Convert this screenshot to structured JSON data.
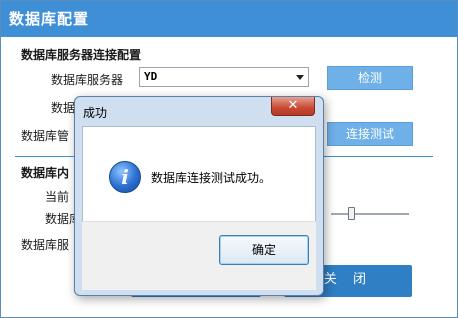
{
  "window": {
    "title": "数据库配置"
  },
  "server_section": {
    "heading": "数据库服务器连接配置",
    "server_label": "数据库服务器",
    "server_value": "YD",
    "detect_button": "检测",
    "row2_label_partial": "数据",
    "row3_label_partial": "数据库管",
    "test_connection_button": "连接测试"
  },
  "db_section": {
    "heading_partial": "数据库内",
    "current_label_partial": "当前",
    "db_label_partial": "数据库",
    "server_label_partial": "数据库服",
    "slider_level": 0.2
  },
  "footer": {
    "close_button": "关 闭"
  },
  "dialog": {
    "title": "成功",
    "close_icon": "close-icon",
    "info_icon": "info-icon",
    "info_icon_glyph": "i",
    "message": "数据库连接测试成功。",
    "ok_button": "确定"
  },
  "colors": {
    "titlebar": "#3f8fd6",
    "button_light": "#6fb0e8",
    "button_dark": "#2f7fc4",
    "close_button": "#c74a34"
  }
}
